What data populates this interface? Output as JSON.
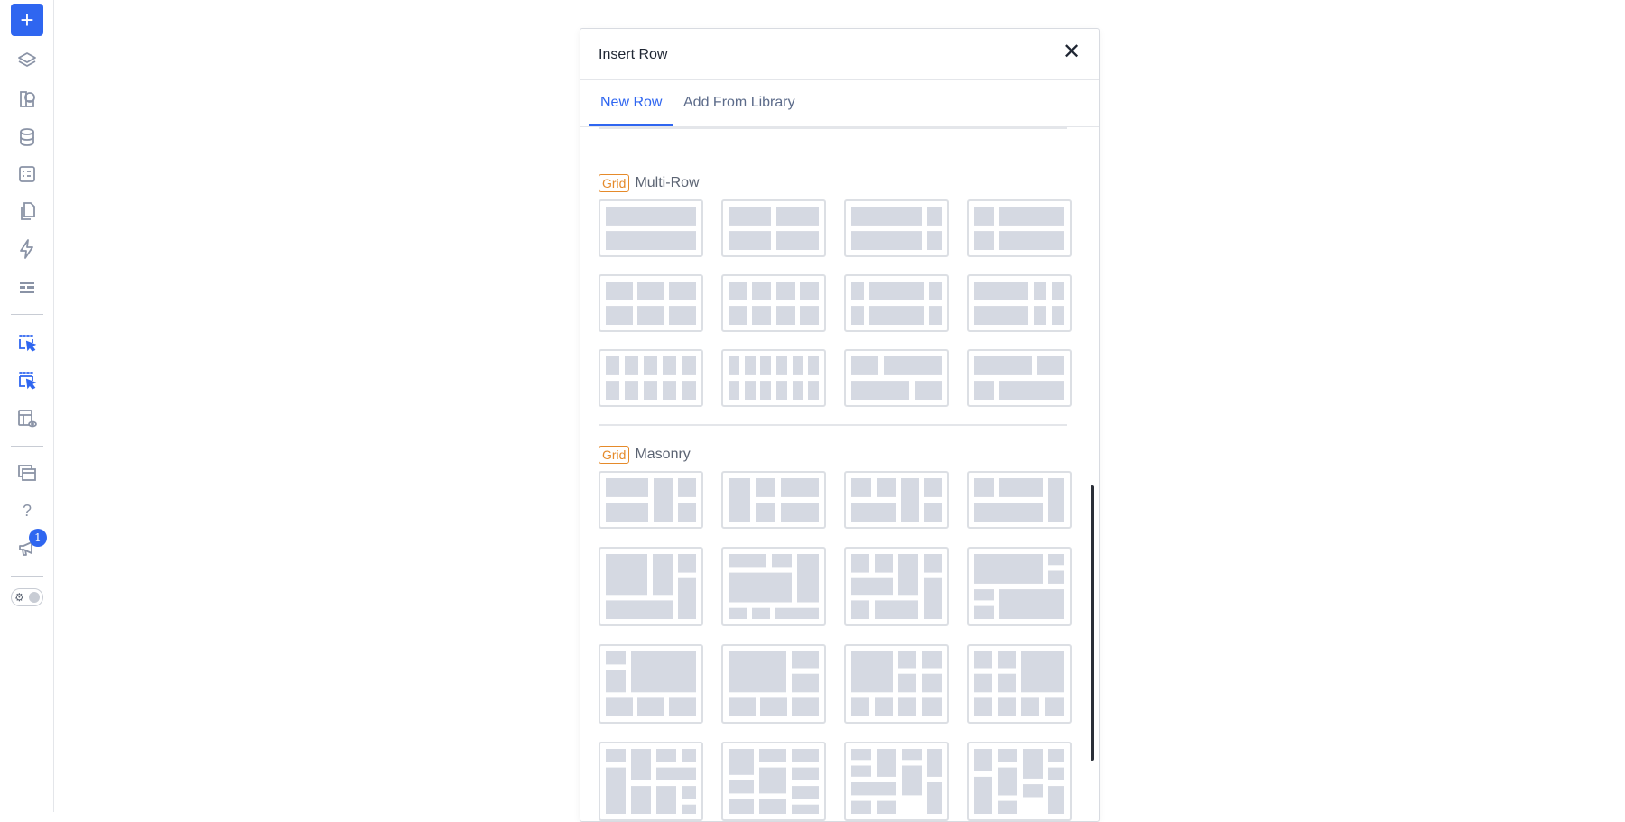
{
  "sidebar": {
    "add_label": "+",
    "icons": [
      "layers-icon",
      "shapes-icon",
      "database-icon",
      "form-icon",
      "copy-icon",
      "lightning-icon",
      "rows-icon",
      "select-cursor-icon",
      "multi-select-cursor-icon",
      "preview-icon",
      "windows-icon",
      "help-icon",
      "megaphone-icon"
    ],
    "help_label": "?",
    "notification_count": "1",
    "toggle_icon": "⚙"
  },
  "modal": {
    "title": "Insert Row",
    "close_label": "✕",
    "tabs": [
      {
        "label": "New Row",
        "active": true
      },
      {
        "label": "Add From Library",
        "active": false
      }
    ],
    "sections": [
      {
        "tag": "Grid",
        "name": "Multi-Row",
        "layouts": 12
      },
      {
        "tag": "Grid",
        "name": "Masonry",
        "layouts": 16
      }
    ]
  },
  "colors": {
    "accent": "#2f66f0",
    "grid_tag": "#e58a2a",
    "placeholder_block": "#d5d9e2"
  }
}
